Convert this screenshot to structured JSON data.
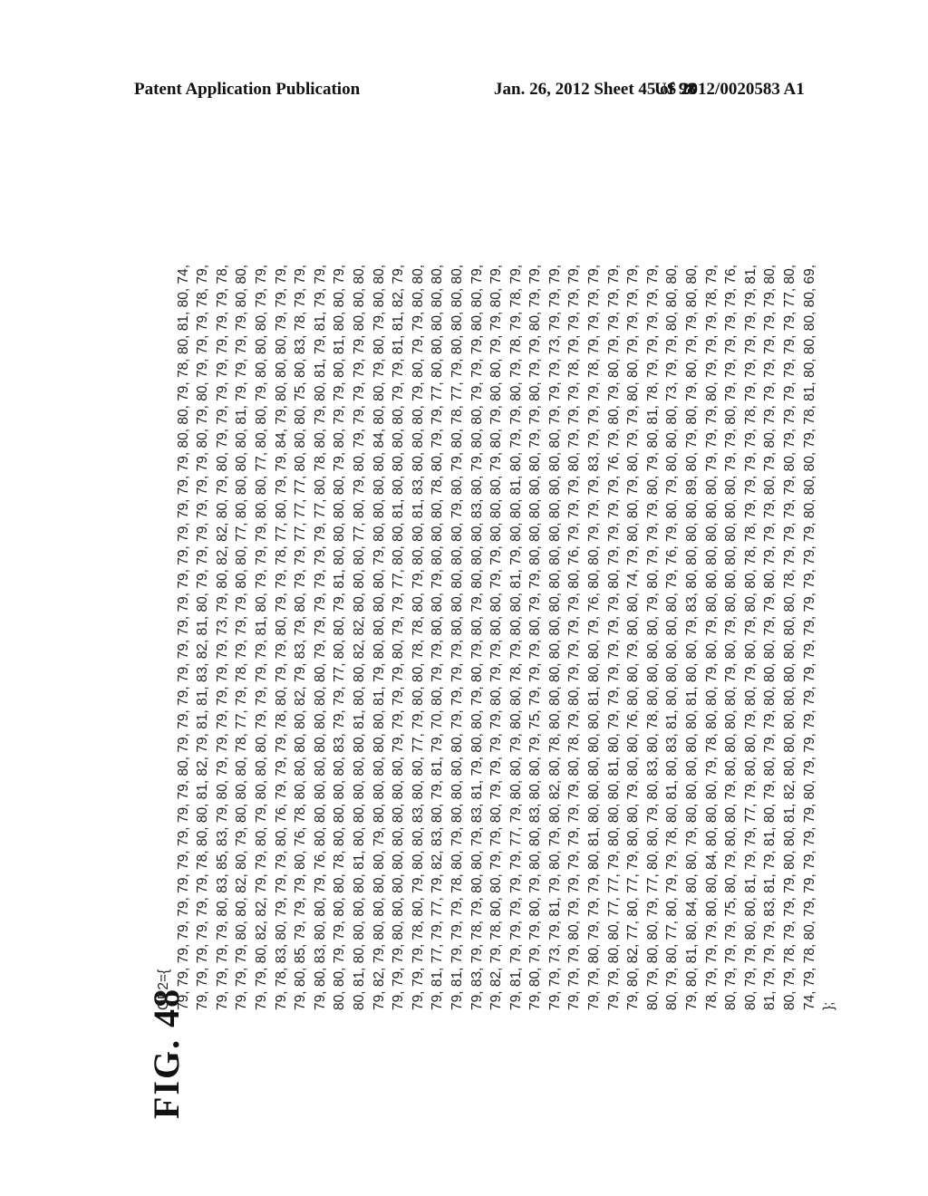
{
  "header": {
    "left": "Patent Application Publication",
    "middle": "Jan. 26, 2012  Sheet 45 of 98",
    "right": "US 2012/0020583 A1"
  },
  "figure": {
    "label": "FIG.  48",
    "code_open": "QP2={",
    "code_close": "};",
    "rows": [
      "79, 79, 79, 79, 79, 79, 79, 79, 79, 79, 80, 79, 79, 79, 79, 79, 79, 79, 79, 79, 79, 79, 79, 79, 80, 80, 79, 78, 80, 81, 80, 74,",
      "79, 79, 79, 79, 79, 79, 78, 80, 80, 81, 82, 79, 81, 81, 83, 82, 81, 80, 79, 79, 79, 79, 79, 79, 80, 79, 80, 79, 79, 79, 78, 79,",
      "79, 79, 79, 79, 80, 83, 85, 83, 79, 80, 79, 79, 79, 79, 79, 79, 73, 79, 80, 82, 82, 80, 79, 80, 79, 79, 79, 79, 79, 79, 79, 78,",
      "79, 79, 79, 80, 80, 82, 80, 79, 80, 80, 80, 78, 77, 79, 78, 79, 79, 79, 80, 80, 77, 80, 80, 80, 80, 81, 79, 79, 79, 79, 80, 80,",
      "79, 79, 80, 82, 82, 79, 79, 80, 79, 80, 80, 80, 79, 79, 79, 79, 81, 80, 79, 79, 79, 80, 80, 77, 80, 80, 79, 80, 80, 80, 79, 79,",
      "79, 78, 83, 80, 79, 79, 79, 80, 76, 79, 79, 79, 78, 80, 79, 79, 80, 79, 79, 78, 77, 80, 79, 79, 84, 79, 80, 80, 80, 79, 79, 79,",
      "79, 80, 85, 79, 79, 79, 80, 76, 78, 80, 80, 80, 80, 82, 79, 83, 79, 80, 79, 79, 77, 77, 77, 80, 80, 80, 75, 80, 83, 78, 79, 79,",
      "79, 80, 83, 80, 80, 79, 76, 80, 80, 80, 80, 80, 80, 80, 80, 79, 79, 79, 79, 79, 79, 77, 80, 78, 80, 79, 80, 81, 79, 81, 79, 79,",
      "80, 80, 79, 79, 80, 80, 78, 80, 80, 80, 80, 83, 79, 79, 77, 80, 80, 79, 81, 80, 80, 80, 80, 79, 80, 79, 79, 80, 81, 80, 80, 79,",
      "80, 81, 80, 80, 80, 80, 81, 80, 80, 80, 80, 80, 81, 80, 80, 82, 82, 80, 80, 80, 77, 80, 79, 80, 79, 79, 79, 79, 79, 80, 80, 80,",
      "79, 82, 79, 80, 80, 80, 80, 79, 80, 80, 80, 80, 80, 81, 79, 80, 80, 80, 80, 79, 80, 80, 80, 80, 84, 80, 80, 79, 80, 79, 80, 80,",
      "79, 79, 79, 80, 80, 80, 80, 80, 80, 80, 80, 79, 79, 79, 79, 80, 79, 79, 77, 80, 80, 81, 80, 80, 80, 80, 79, 79, 81, 81, 82, 79,",
      "79, 79, 79, 78, 80, 79, 80, 80, 83, 80, 80, 77, 79, 80, 80, 78, 78, 80, 79, 80, 80, 81, 83, 80, 80, 80, 79, 80, 79, 79, 80, 80,",
      "79, 81, 77, 79, 77, 79, 82, 83, 80, 79, 81, 79, 70, 80, 79, 79, 80, 80, 79, 80, 80, 80, 78, 80, 79, 79, 77, 80, 80, 80, 80, 80,",
      "79, 81, 79, 79, 79, 78, 80, 79, 80, 80, 80, 80, 79, 79, 79, 79, 80, 80, 80, 80, 80, 79, 80, 79, 80, 78, 77, 79, 80, 80, 80, 80,",
      "79, 83, 79, 78, 79, 80, 80, 79, 83, 81, 79, 80, 80, 79, 80, 79, 80, 79, 80, 80, 80, 83, 80, 79, 80, 80, 79, 79, 79, 80, 80, 79,",
      "79, 82, 79, 78, 80, 80, 79, 79, 80, 79, 79, 79, 79, 80, 79, 79, 80, 80, 79, 79, 80, 80, 80, 79, 80, 79, 80, 80, 79, 79, 80, 79,",
      "79, 81, 79, 79, 79, 79, 79, 77, 79, 80, 80, 79, 80, 80, 78, 79, 80, 80, 81, 79, 80, 80, 81, 80, 79, 79, 80, 79, 78, 79, 78, 79,",
      "79, 80, 79, 79, 80, 79, 80, 80, 83, 80, 80, 79, 75, 79, 79, 79, 80, 79, 79, 80, 80, 80, 80, 80, 79, 79, 80, 79, 79, 80, 79, 79,",
      "79, 79, 73, 79, 81, 79, 80, 79, 80, 82, 80, 78, 80, 80, 80, 80, 80, 80, 80, 80, 80, 80, 80, 80, 80, 79, 79, 79, 73, 79, 79, 79,",
      "79, 79, 79, 80, 79, 79, 79, 79, 79, 79, 80, 78, 79, 80, 79, 79, 79, 79, 80, 76, 79, 79, 79, 80, 79, 79, 79, 78, 79, 79, 79, 79,",
      "79, 79, 80, 79, 79, 79, 80, 81, 80, 80, 80, 80, 80, 81, 80, 80, 79, 76, 80, 80, 79, 79, 79, 83, 79, 79, 79, 78, 79, 79, 79, 79,",
      "79, 79, 80, 80, 77, 77, 79, 80, 80, 80, 81, 80, 79, 79, 79, 79, 79, 79, 80, 79, 79, 79, 79, 76, 79, 80, 79, 80, 79, 79, 79, 79,",
      "79, 80, 82, 77, 80, 77, 79, 80, 80, 79, 80, 80, 76, 80, 80, 79, 80, 80, 74, 79, 80, 80, 79, 80, 79, 79, 80, 80, 79, 79, 79, 79,",
      "80, 79, 80, 80, 79, 77, 80, 80, 79, 80, 83, 80, 78, 80, 80, 80, 80, 79, 80, 79, 79, 79, 80, 79, 80, 81, 78, 79, 79, 79, 79, 79,",
      "80, 79, 80, 77, 80, 79, 79, 78, 80, 81, 80, 83, 81, 80, 80, 80, 80, 80, 79, 76, 79, 80, 79, 80, 80, 80, 73, 79, 79, 80, 80, 80,",
      "79, 80, 81, 80, 84, 80, 80, 79, 80, 80, 80, 80, 80, 81, 80, 80, 79, 83, 80, 80, 80, 80, 89, 80, 79, 80, 79, 80, 79, 79, 80, 80,",
      "78, 79, 79, 79, 80, 80, 84, 80, 80, 80, 79, 78, 80, 80, 79, 80, 79, 80, 80, 80, 80, 80, 80, 79, 79, 79, 80, 79, 79, 79, 78, 79,",
      "80, 79, 79, 79, 75, 80, 79, 80, 80, 79, 80, 80, 80, 80, 79, 80, 79, 80, 80, 80, 80, 80, 80, 79, 79, 80, 79, 79, 79, 79, 79, 76,",
      "80, 79, 79, 80, 80, 81, 79, 79, 77, 79, 80, 80, 79, 80, 79, 80, 79, 80, 80, 78, 78, 79, 79, 79, 79, 78, 79, 79, 79, 79, 79, 81,",
      "81, 79, 79, 79, 83, 81, 79, 81, 80, 79, 80, 79, 79, 80, 80, 80, 79, 79, 80, 79, 79, 79, 80, 79, 80, 79, 79, 79, 79, 79, 79, 80,",
      "80, 79, 78, 79, 79, 79, 80, 80, 81, 82, 80, 80, 80, 80, 80, 80, 80, 80, 78, 79, 79, 79, 79, 80, 79, 79, 79, 79, 79, 79, 77, 80,",
      "74, 79, 78, 80, 79, 79, 79, 79, 79, 80, 79, 79, 79, 79, 79, 79, 79, 79, 79, 79, 79, 80, 80, 80, 79, 78, 81, 80, 80, 80, 80, 69,"
    ]
  }
}
